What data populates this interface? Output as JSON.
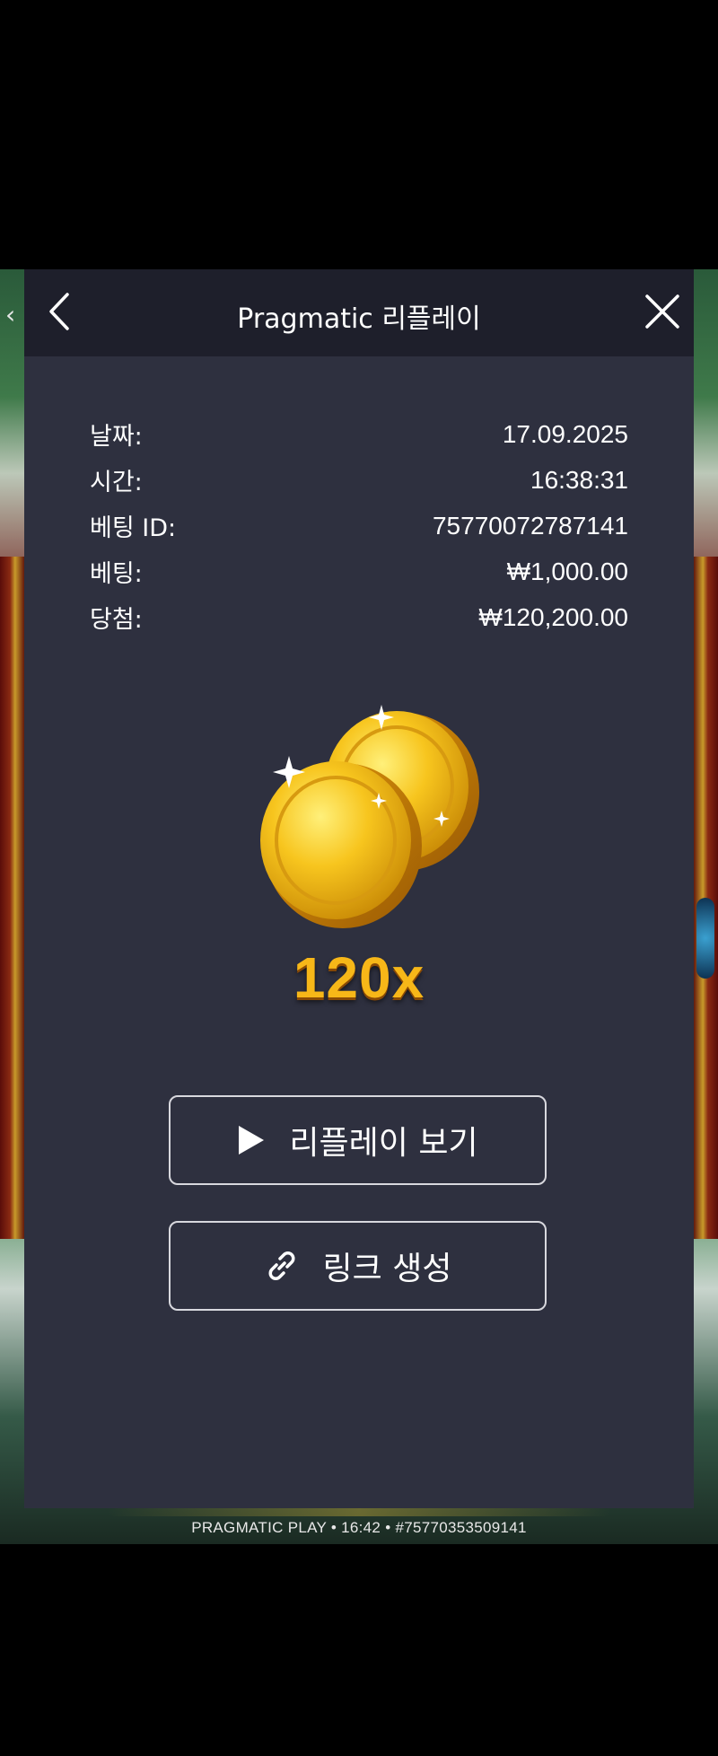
{
  "background": {
    "footer": "PRAGMATIC PLAY • 16:42 • #75770353509141"
  },
  "modal": {
    "title": "Pragmatic 리플레이",
    "details": [
      {
        "label": "날짜:",
        "value": "17.09.2025"
      },
      {
        "label": "시간:",
        "value": "16:38:31"
      },
      {
        "label": "베팅 ID:",
        "value": "75770072787141"
      },
      {
        "label": "베팅:",
        "value": "₩1,000.00"
      },
      {
        "label": "당첨:",
        "value": "₩120,200.00"
      }
    ],
    "multiplier": "120x",
    "replay_button": "리플레이 보기",
    "link_button": "링크 생성"
  },
  "icons": {
    "back": "chevron-left-icon",
    "close": "close-icon",
    "play": "play-icon",
    "link": "link-icon",
    "coins": "gold-coins-icon"
  },
  "colors": {
    "modal_bg": "#2e303f",
    "header_bg": "#1e1f2b",
    "multiplier": "#f7b718"
  }
}
